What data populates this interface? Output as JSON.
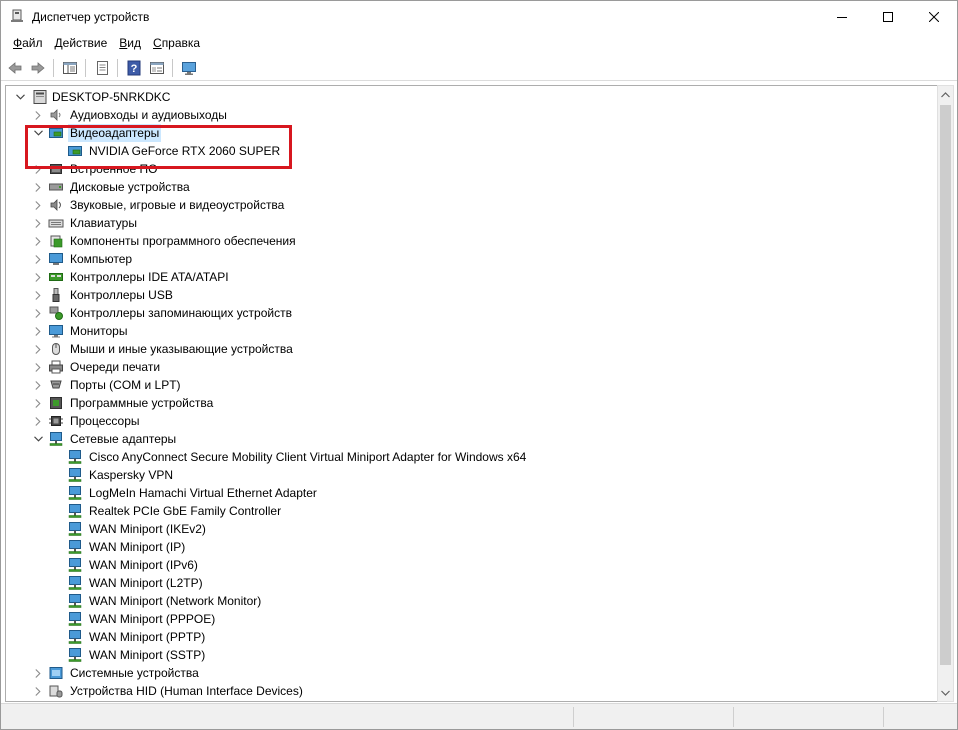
{
  "window": {
    "title": "Диспетчер устройств"
  },
  "menu": [
    {
      "label": "Файл",
      "accel": "Ф",
      "rest": "айл"
    },
    {
      "label": "Действие",
      "accel": "Д",
      "rest": "ействие"
    },
    {
      "label": "Вид",
      "accel": "В",
      "rest": "ид"
    },
    {
      "label": "Справка",
      "accel": "С",
      "rest": "правка"
    }
  ],
  "toolbar": [
    "back-icon",
    "forward-icon",
    "properties-icon",
    "page-icon",
    "help-icon",
    "view-icon",
    "monitor-scan-icon"
  ],
  "tree": {
    "root": "DESKTOP-5NRKDKC",
    "items": [
      {
        "label": "Аудиовходы и аудиовыходы",
        "icon": "audio-io-icon",
        "level": 1,
        "state": "collapsed"
      },
      {
        "label": "Видеоадаптеры",
        "icon": "display-adapter-icon",
        "level": 1,
        "state": "expanded",
        "selected": true
      },
      {
        "label": "NVIDIA GeForce RTX 2060 SUPER",
        "icon": "display-adapter-icon",
        "level": 2,
        "state": "none"
      },
      {
        "label": "Встроенное ПО",
        "icon": "firmware-icon",
        "level": 1,
        "state": "collapsed"
      },
      {
        "label": "Дисковые устройства",
        "icon": "disk-icon",
        "level": 1,
        "state": "collapsed"
      },
      {
        "label": "Звуковые, игровые и видеоустройства",
        "icon": "speaker-icon",
        "level": 1,
        "state": "collapsed"
      },
      {
        "label": "Клавиатуры",
        "icon": "keyboard-icon",
        "level": 1,
        "state": "collapsed"
      },
      {
        "label": "Компоненты программного обеспечения",
        "icon": "software-component-icon",
        "level": 1,
        "state": "collapsed"
      },
      {
        "label": "Компьютер",
        "icon": "computer-icon",
        "level": 1,
        "state": "collapsed"
      },
      {
        "label": "Контроллеры IDE ATA/ATAPI",
        "icon": "ide-controller-icon",
        "level": 1,
        "state": "collapsed"
      },
      {
        "label": "Контроллеры USB",
        "icon": "usb-icon",
        "level": 1,
        "state": "collapsed"
      },
      {
        "label": "Контроллеры запоминающих устройств",
        "icon": "storage-controller-icon",
        "level": 1,
        "state": "collapsed"
      },
      {
        "label": "Мониторы",
        "icon": "monitor-icon",
        "level": 1,
        "state": "collapsed"
      },
      {
        "label": "Мыши и иные указывающие устройства",
        "icon": "mouse-icon",
        "level": 1,
        "state": "collapsed"
      },
      {
        "label": "Очереди печати",
        "icon": "printer-icon",
        "level": 1,
        "state": "collapsed"
      },
      {
        "label": "Порты (COM и LPT)",
        "icon": "port-icon",
        "level": 1,
        "state": "collapsed"
      },
      {
        "label": "Программные устройства",
        "icon": "software-device-icon",
        "level": 1,
        "state": "collapsed"
      },
      {
        "label": "Процессоры",
        "icon": "processor-icon",
        "level": 1,
        "state": "collapsed"
      },
      {
        "label": "Сетевые адаптеры",
        "icon": "network-adapter-icon",
        "level": 1,
        "state": "expanded"
      },
      {
        "label": "Cisco AnyConnect Secure Mobility Client Virtual Miniport Adapter for Windows x64",
        "icon": "network-adapter-icon",
        "level": 2,
        "state": "none"
      },
      {
        "label": "Kaspersky VPN",
        "icon": "network-adapter-icon",
        "level": 2,
        "state": "none"
      },
      {
        "label": "LogMeIn Hamachi Virtual Ethernet Adapter",
        "icon": "network-adapter-icon",
        "level": 2,
        "state": "none"
      },
      {
        "label": "Realtek PCIe GbE Family Controller",
        "icon": "network-adapter-icon",
        "level": 2,
        "state": "none"
      },
      {
        "label": "WAN Miniport (IKEv2)",
        "icon": "network-adapter-icon",
        "level": 2,
        "state": "none"
      },
      {
        "label": "WAN Miniport (IP)",
        "icon": "network-adapter-icon",
        "level": 2,
        "state": "none"
      },
      {
        "label": "WAN Miniport (IPv6)",
        "icon": "network-adapter-icon",
        "level": 2,
        "state": "none"
      },
      {
        "label": "WAN Miniport (L2TP)",
        "icon": "network-adapter-icon",
        "level": 2,
        "state": "none"
      },
      {
        "label": "WAN Miniport (Network Monitor)",
        "icon": "network-adapter-icon",
        "level": 2,
        "state": "none"
      },
      {
        "label": "WAN Miniport (PPPOE)",
        "icon": "network-adapter-icon",
        "level": 2,
        "state": "none"
      },
      {
        "label": "WAN Miniport (PPTP)",
        "icon": "network-adapter-icon",
        "level": 2,
        "state": "none"
      },
      {
        "label": "WAN Miniport (SSTP)",
        "icon": "network-adapter-icon",
        "level": 2,
        "state": "none"
      },
      {
        "label": "Системные устройства",
        "icon": "system-device-icon",
        "level": 1,
        "state": "collapsed"
      },
      {
        "label": "Устройства HID (Human Interface Devices)",
        "icon": "hid-icon",
        "level": 1,
        "state": "collapsed"
      }
    ]
  },
  "colors": {
    "highlight_border": "#d7171f",
    "selection": "#cce8ff",
    "accent_green": "#3c9a2a",
    "monitor_blue": "#2b82c9"
  }
}
